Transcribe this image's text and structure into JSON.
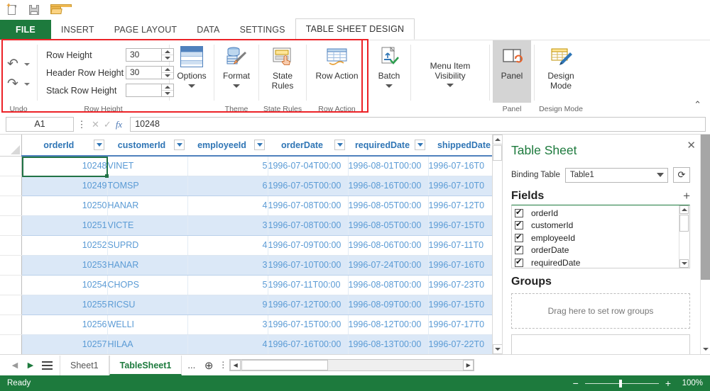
{
  "quick_access": [
    {
      "name": "new-icon",
      "label": "New"
    },
    {
      "name": "save-icon",
      "label": "Save"
    },
    {
      "name": "open-icon",
      "label": "Open"
    }
  ],
  "ribbon_tabs": [
    {
      "label": "FILE",
      "active": false,
      "file": true
    },
    {
      "label": "INSERT",
      "active": false
    },
    {
      "label": "PAGE LAYOUT",
      "active": false
    },
    {
      "label": "DATA",
      "active": false
    },
    {
      "label": "SETTINGS",
      "active": false
    },
    {
      "label": "TABLE SHEET DESIGN",
      "active": true
    }
  ],
  "ribbon": {
    "undo_group": {
      "label": "Undo",
      "undo_icon": "undo-arrow-icon",
      "redo_icon": "redo-arrow-icon"
    },
    "row_height_group": {
      "label": "Row Height",
      "fields": [
        {
          "label": "Row Height",
          "value": "30"
        },
        {
          "label": "Header Row Height",
          "value": "30"
        },
        {
          "label": "Stack Row Height",
          "value": ""
        }
      ]
    },
    "options_button": {
      "label": "Options",
      "icon": "table-options-icon",
      "has_caret": true
    },
    "theme_group": {
      "label": "Theme",
      "button": {
        "label": "Format",
        "icon": "format-paintbrush-icon",
        "has_caret": true
      }
    },
    "state_rules_group": {
      "label": "State Rules",
      "button": {
        "label_line1": "State",
        "label_line2": "Rules",
        "icon": "state-rules-icon"
      }
    },
    "row_action_group": {
      "label": "Row Action",
      "button": {
        "label": "Row Action",
        "icon": "row-action-icon"
      }
    },
    "batch_button": {
      "label": "Batch",
      "icon": "batch-upload-icon",
      "has_caret": true
    },
    "menu_visibility_button": {
      "label": "Menu Item Visibility",
      "has_caret": true
    },
    "panel_group": {
      "label": "Panel",
      "button": {
        "label": "Panel",
        "icon": "panel-toggle-icon",
        "active": true
      }
    },
    "design_mode_group": {
      "label": "Design Mode",
      "button": {
        "label_line1": "Design",
        "label_line2": "Mode",
        "icon": "design-mode-pencil-icon"
      }
    },
    "collapse_icon": "chevron-up-icon"
  },
  "formula_bar": {
    "name_box": "A1",
    "menu_icon": "vertical-dots-icon",
    "cancel_icon": "cancel-x-icon",
    "confirm_icon": "confirm-check-icon",
    "function_icon": "fx-icon",
    "value": "10248"
  },
  "grid": {
    "columns": [
      "orderId",
      "customerId",
      "employeeId",
      "orderDate",
      "requiredDate",
      "shippedDate"
    ],
    "filter_icon": "filter-dropdown-icon",
    "selected_cell": "A1",
    "rows": [
      {
        "orderId": "10248",
        "customerId": "VINET",
        "employeeId": "5",
        "orderDate": "1996-07-04T00:00",
        "requiredDate": "1996-08-01T00:00",
        "shippedDate": "1996-07-16T0"
      },
      {
        "orderId": "10249",
        "customerId": "TOMSP",
        "employeeId": "6",
        "orderDate": "1996-07-05T00:00",
        "requiredDate": "1996-08-16T00:00",
        "shippedDate": "1996-07-10T0"
      },
      {
        "orderId": "10250",
        "customerId": "HANAR",
        "employeeId": "4",
        "orderDate": "1996-07-08T00:00",
        "requiredDate": "1996-08-05T00:00",
        "shippedDate": "1996-07-12T0"
      },
      {
        "orderId": "10251",
        "customerId": "VICTE",
        "employeeId": "3",
        "orderDate": "1996-07-08T00:00",
        "requiredDate": "1996-08-05T00:00",
        "shippedDate": "1996-07-15T0"
      },
      {
        "orderId": "10252",
        "customerId": "SUPRD",
        "employeeId": "4",
        "orderDate": "1996-07-09T00:00",
        "requiredDate": "1996-08-06T00:00",
        "shippedDate": "1996-07-11T0"
      },
      {
        "orderId": "10253",
        "customerId": "HANAR",
        "employeeId": "3",
        "orderDate": "1996-07-10T00:00",
        "requiredDate": "1996-07-24T00:00",
        "shippedDate": "1996-07-16T0"
      },
      {
        "orderId": "10254",
        "customerId": "CHOPS",
        "employeeId": "5",
        "orderDate": "1996-07-11T00:00",
        "requiredDate": "1996-08-08T00:00",
        "shippedDate": "1996-07-23T0"
      },
      {
        "orderId": "10255",
        "customerId": "RICSU",
        "employeeId": "9",
        "orderDate": "1996-07-12T00:00",
        "requiredDate": "1996-08-09T00:00",
        "shippedDate": "1996-07-15T0"
      },
      {
        "orderId": "10256",
        "customerId": "WELLI",
        "employeeId": "3",
        "orderDate": "1996-07-15T00:00",
        "requiredDate": "1996-08-12T00:00",
        "shippedDate": "1996-07-17T0"
      },
      {
        "orderId": "10257",
        "customerId": "HILAA",
        "employeeId": "4",
        "orderDate": "1996-07-16T00:00",
        "requiredDate": "1996-08-13T00:00",
        "shippedDate": "1996-07-22T0"
      }
    ]
  },
  "panel": {
    "title": "Table Sheet",
    "close_icon": "close-icon",
    "binding_label": "Binding Table",
    "binding_value": "Table1",
    "refresh_icon": "refresh-icon",
    "fields_title": "Fields",
    "add_field_icon": "plus-icon",
    "fields": [
      {
        "name": "orderId",
        "checked": true
      },
      {
        "name": "customerId",
        "checked": true
      },
      {
        "name": "employeeId",
        "checked": true
      },
      {
        "name": "orderDate",
        "checked": true
      },
      {
        "name": "requiredDate",
        "checked": true
      }
    ],
    "groups_title": "Groups",
    "groups_placeholder": "Drag here to set row groups"
  },
  "sheet_bar": {
    "prev_icon": "nav-prev-icon",
    "next_icon": "nav-next-icon",
    "sheet_list_icon": "sheet-list-icon",
    "tabs": [
      {
        "label": "Sheet1",
        "active": false
      },
      {
        "label": "TableSheet1",
        "active": true
      }
    ],
    "overflow_label": "...",
    "add_sheet_icon": "add-sheet-icon",
    "options_icon": "vertical-dots-icon"
  },
  "status_bar": {
    "status": "Ready",
    "zoom_out_icon": "minus-icon",
    "zoom_in_icon": "plus-icon",
    "zoom_level": "100%"
  },
  "colors": {
    "accent_green": "#1d7a3d",
    "header_blue": "#2f75b5",
    "cell_blue": "#5b9bd5",
    "band_blue": "#dbe8f7",
    "highlight_red": "#ec2227"
  }
}
